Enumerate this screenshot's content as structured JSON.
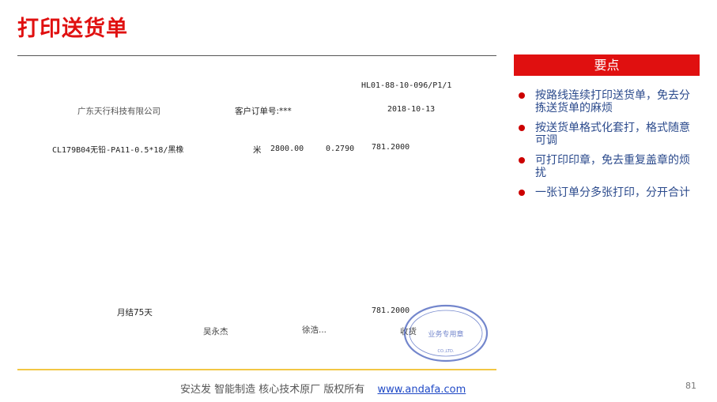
{
  "slide": {
    "title": "打印送货单",
    "page_number": "81"
  },
  "document": {
    "form_code": "HL01-88-10-096/P1/1",
    "company": "广东天行科技有限公司",
    "customer_order_label": "客户订单号:***",
    "date": "2018-10-13",
    "item": {
      "description": "CL179B04无铅-PA11-0.5*18/黑橡",
      "unit": "米",
      "quantity": "2800.00",
      "price": "0.2790",
      "amount": "781.2000"
    },
    "payment_terms": "月结75天",
    "total": "781.2000",
    "signature_left": "吴永杰",
    "signature_mid": "徐浩...",
    "signature_right": "收货"
  },
  "panel": {
    "heading": "要点",
    "bullets": [
      "按路线连续打印送货单，免去分拣送货单的麻烦",
      "按送货单格式化套打，格式随意可调",
      "可打印印章，免去重复盖章的烦扰",
      "一张订单分多张打印，分开合计"
    ]
  },
  "footer": {
    "text": "安达发   智能制造 核心技术原厂    版权所有",
    "link": "www.andafa.com"
  },
  "colors": {
    "accent_red": "#e01010",
    "bullet_text": "#2b4a8c",
    "rule_yellow": "#f2c744",
    "stamp_blue": "#5b72c4"
  }
}
